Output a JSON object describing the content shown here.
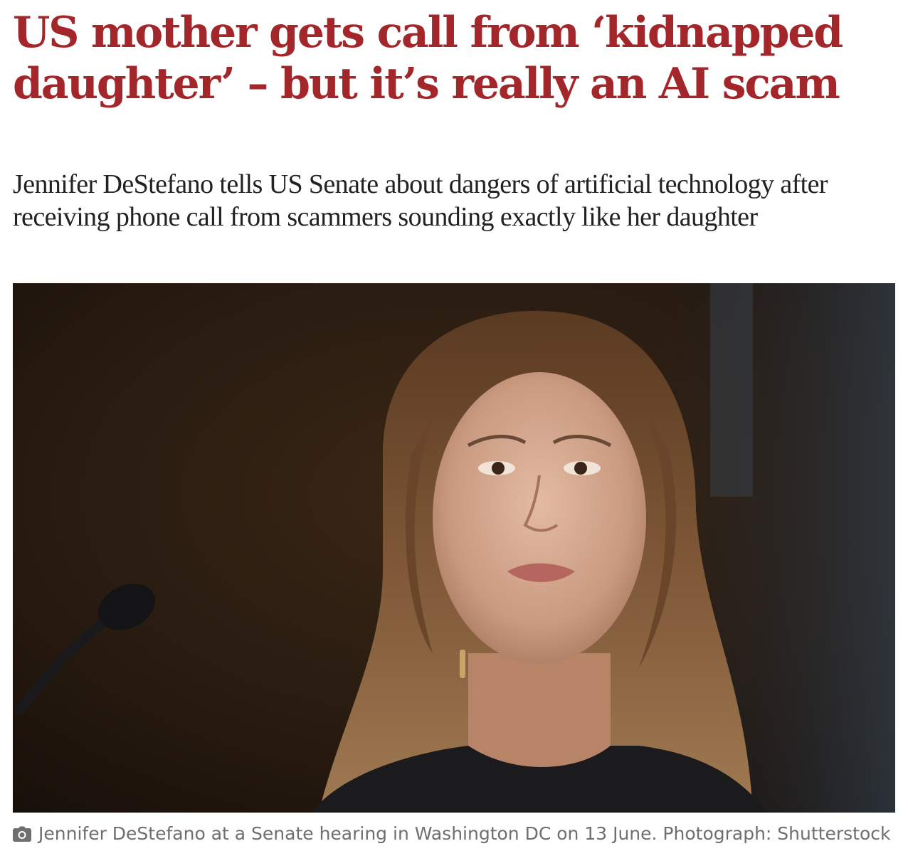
{
  "article": {
    "headline": "US mother gets call from ‘kidnapped daughter’ – but it’s really an AI scam",
    "standfirst": "Jennifer DeStefano tells US Senate about dangers of artificial technology after receiving phone call from scammers sounding exactly like her daughter",
    "photo": {
      "icon": "camera-icon",
      "caption": "Jennifer DeStefano at a Senate hearing in Washington DC on 13 June. Photograph: Shutterstock"
    }
  },
  "colors": {
    "headline": "#a3262a",
    "standfirst": "#222222",
    "caption": "#6f6f6f",
    "background": "#ffffff"
  }
}
